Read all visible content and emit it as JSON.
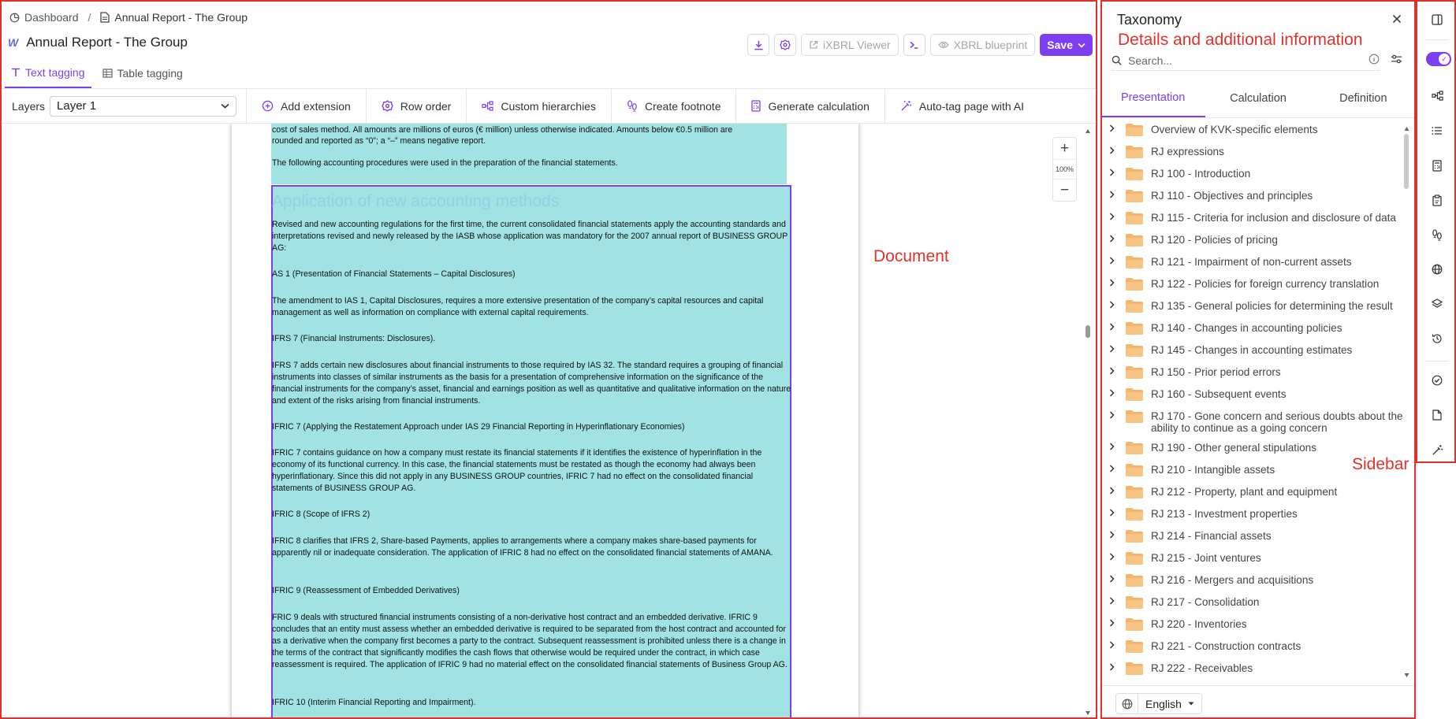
{
  "breadcrumb": {
    "home": "Dashboard",
    "separator": "/",
    "current": "Annual Report - The Group"
  },
  "header": {
    "title": "Annual Report - The Group",
    "ixbrl_viewer": "iXBRL Viewer",
    "xbrl_blueprint": "XBRL blueprint",
    "save": "Save"
  },
  "tabs": [
    {
      "label": "Text tagging",
      "active": true
    },
    {
      "label": "Table tagging",
      "active": false
    }
  ],
  "toolbar": {
    "layers_label": "Layers",
    "layer_value": "Layer 1",
    "items": [
      "Add extension",
      "Row order",
      "Custom hierarchies",
      "Create footnote",
      "Generate calculation",
      "Auto-tag page with AI"
    ]
  },
  "document": {
    "intro_lines": [
      "cost of sales method. All amounts are millions of euros (€ million) unless otherwise indicated. Amounts below €0.5 million are",
      "rounded and reported as “0”; a “–” means negative report.",
      "The following accounting procedures were used in the preparation of the financial statements."
    ],
    "heading": "Application of new accounting methods",
    "paragraphs": [
      "Revised and new accounting regulations for the first time, the current consolidated financial statements apply the accounting standards and interpretations revised and newly released by the IASB whose application was mandatory for the 2007 annual report of BUSINESS GROUP AG:",
      "AS 1 (Presentation of Financial Statements – Capital Disclosures)",
      "The amendment to IAS 1, Capital Disclosures, requires a more extensive presentation of the company’s capital resources and capital management as well as information on compliance with external capital requirements.",
      "IFRS 7 (Financial Instruments: Disclosures).",
      "IFRS 7 adds certain new disclosures about financial instruments to those required by IAS 32. The standard requires a grouping of financial instruments into classes of similar instruments as the basis for a presentation of comprehensive information on the significance of the financial instruments for the company’s asset, financial and earnings position as well as quantitative and qualitative information on the nature and extent of the risks arising from financial instruments.",
      "IFRIC 7 (Applying the Restatement Approach under IAS 29 Financial Reporting in Hyperinflationary Economies)",
      "IFRIC 7 contains guidance on how a company must restate its financial statements if it identifies the existence of hyperinflation in the economy of its functional currency. In this case, the financial statements must be restated as though the economy had always been hyperinflationary. Since this did not apply in any BUSINESS GROUP countries, IFRIC 7 had no effect on the consolidated financial statements of BUSINESS GROUP AG.",
      "IFRIC 8 (Scope of IFRS 2)",
      "IFRIC 8 clarifies that IFRS 2, Share-based Payments, applies to arrangements where a company makes share-based payments for apparently nil or inadequate consideration. The application of IFRIC 8 had no effect on the consolidated financial statements of AMANA.",
      "IFRIC 9 (Reassessment of Embedded Derivatives)",
      "FRIC 9 deals with structured financial instruments consisting of a non-derivative host contract and an embedded derivative. IFRIC 9 concludes that an entity must assess whether an embedded derivative is required to be separated from the host contract and accounted for as a derivative when the company first becomes a party to the contract. Subsequent reassessment is prohibited unless there is a change in the terms of the contract that significantly modifies the cash flows that otherwise would be required under the contract, in which case reassessment is required. The application of IFRIC 9 had no material effect on the consolidated financial statements of Business Group AG.",
      "IFRIC 10 (Interim Financial Reporting and Impairment)."
    ],
    "zoom_level": "100%"
  },
  "sidebar": {
    "title": "Taxonomy",
    "search_placeholder": "Search...",
    "tabs": [
      {
        "label": "Presentation",
        "active": true
      },
      {
        "label": "Calculation",
        "active": false
      },
      {
        "label": "Definition",
        "active": false
      }
    ],
    "items": [
      "Overview of KVK-specific elements",
      "RJ expressions",
      "RJ 100 - Introduction",
      "RJ 110 - Objectives and principles",
      "RJ 115 - Criteria for inclusion and disclosure of data",
      "RJ 120 - Policies of pricing",
      "RJ 121 - Impairment of non-current assets",
      "RJ 122 - Policies for foreign currency translation",
      "RJ 135 - General policies for determining the result",
      "RJ 140 - Changes in accounting policies",
      "RJ 145 - Changes in accounting estimates",
      "RJ 150 - Prior period errors",
      "RJ 160 - Subsequent events",
      "RJ 170 - Gone concern and serious doubts about the ability to continue as a going concern",
      "RJ 190 - Other general stipulations",
      "RJ 210 - Intangible assets",
      "RJ 212 - Property, plant and equipment",
      "RJ 213 - Investment properties",
      "RJ 214 - Financial assets",
      "RJ 215 - Joint ventures",
      "RJ 216 - Mergers and acquisitions",
      "RJ 217 - Consolidation",
      "RJ 220 - Inventories",
      "RJ 221 - Construction contracts",
      "RJ 222 - Receivables"
    ],
    "language": "English"
  },
  "annotations": {
    "details": "Details and additional information",
    "document": "Document",
    "sidebar": "Sidebar"
  },
  "colors": {
    "accent": "#7e3ff2",
    "tag_fill": "#a1e3e3",
    "annotation": "#e0312c",
    "folder": "#f2b36b"
  }
}
